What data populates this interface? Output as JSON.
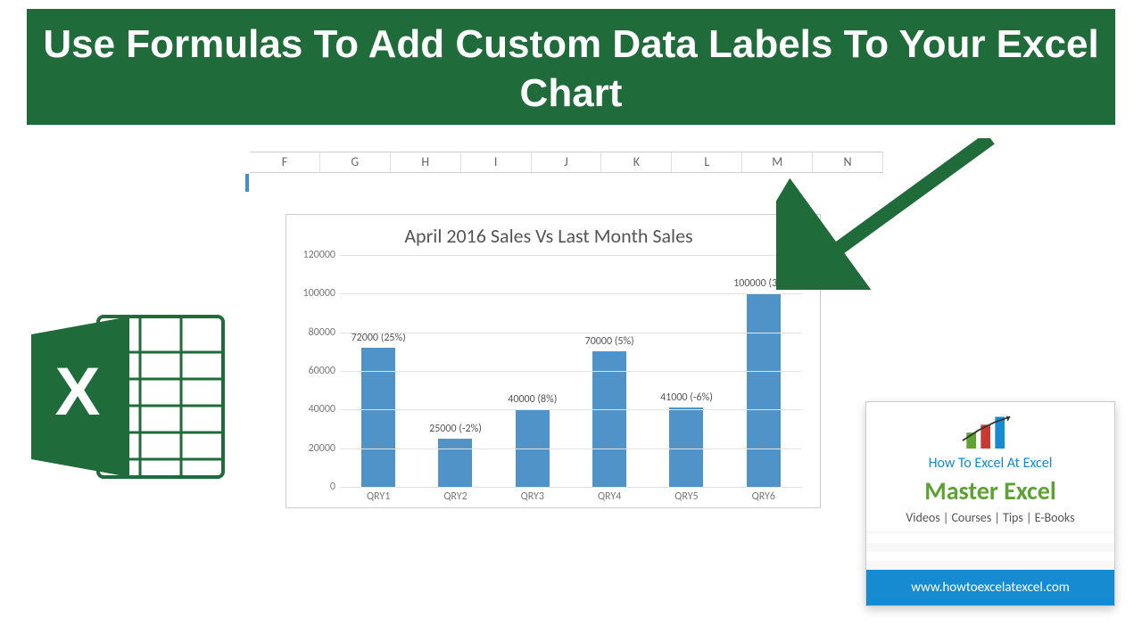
{
  "banner": {
    "title": "Use Formulas To Add Custom Data Labels To Your Excel Chart"
  },
  "column_headers": [
    "F",
    "G",
    "H",
    "I",
    "J",
    "K",
    "L",
    "M",
    "N"
  ],
  "chart_data": {
    "type": "bar",
    "title": "April 2016 Sales Vs Last Month Sales",
    "categories": [
      "QRY1",
      "QRY2",
      "QRY3",
      "QRY4",
      "QRY5",
      "QRY6"
    ],
    "values": [
      72000,
      25000,
      40000,
      70000,
      41000,
      100000
    ],
    "pct_labels": [
      "25%",
      "-2%",
      "8%",
      "5%",
      "-6%",
      "31%"
    ],
    "data_labels": [
      "72000 (25%)",
      "25000 (-2%)",
      "40000 (8%)",
      "70000 (5%)",
      "41000 (-6%)",
      "100000 (31%)"
    ],
    "y_ticks": [
      0,
      20000,
      40000,
      60000,
      80000,
      100000,
      120000
    ],
    "ylim": [
      0,
      120000
    ],
    "xlabel": "",
    "ylabel": "",
    "bar_color": "#4f93c9"
  },
  "promo": {
    "line1": "How To Excel At Excel",
    "line2": "Master Excel",
    "line3": "Videos | Courses | Tips | E-Books",
    "url": "www.howtoexcelatexcel.com"
  },
  "colors": {
    "banner": "#1f6b3a",
    "excel_green": "#1f6b3a",
    "bar": "#4f93c9",
    "promo_blue": "#178bd1",
    "promo_green": "#5da233"
  }
}
